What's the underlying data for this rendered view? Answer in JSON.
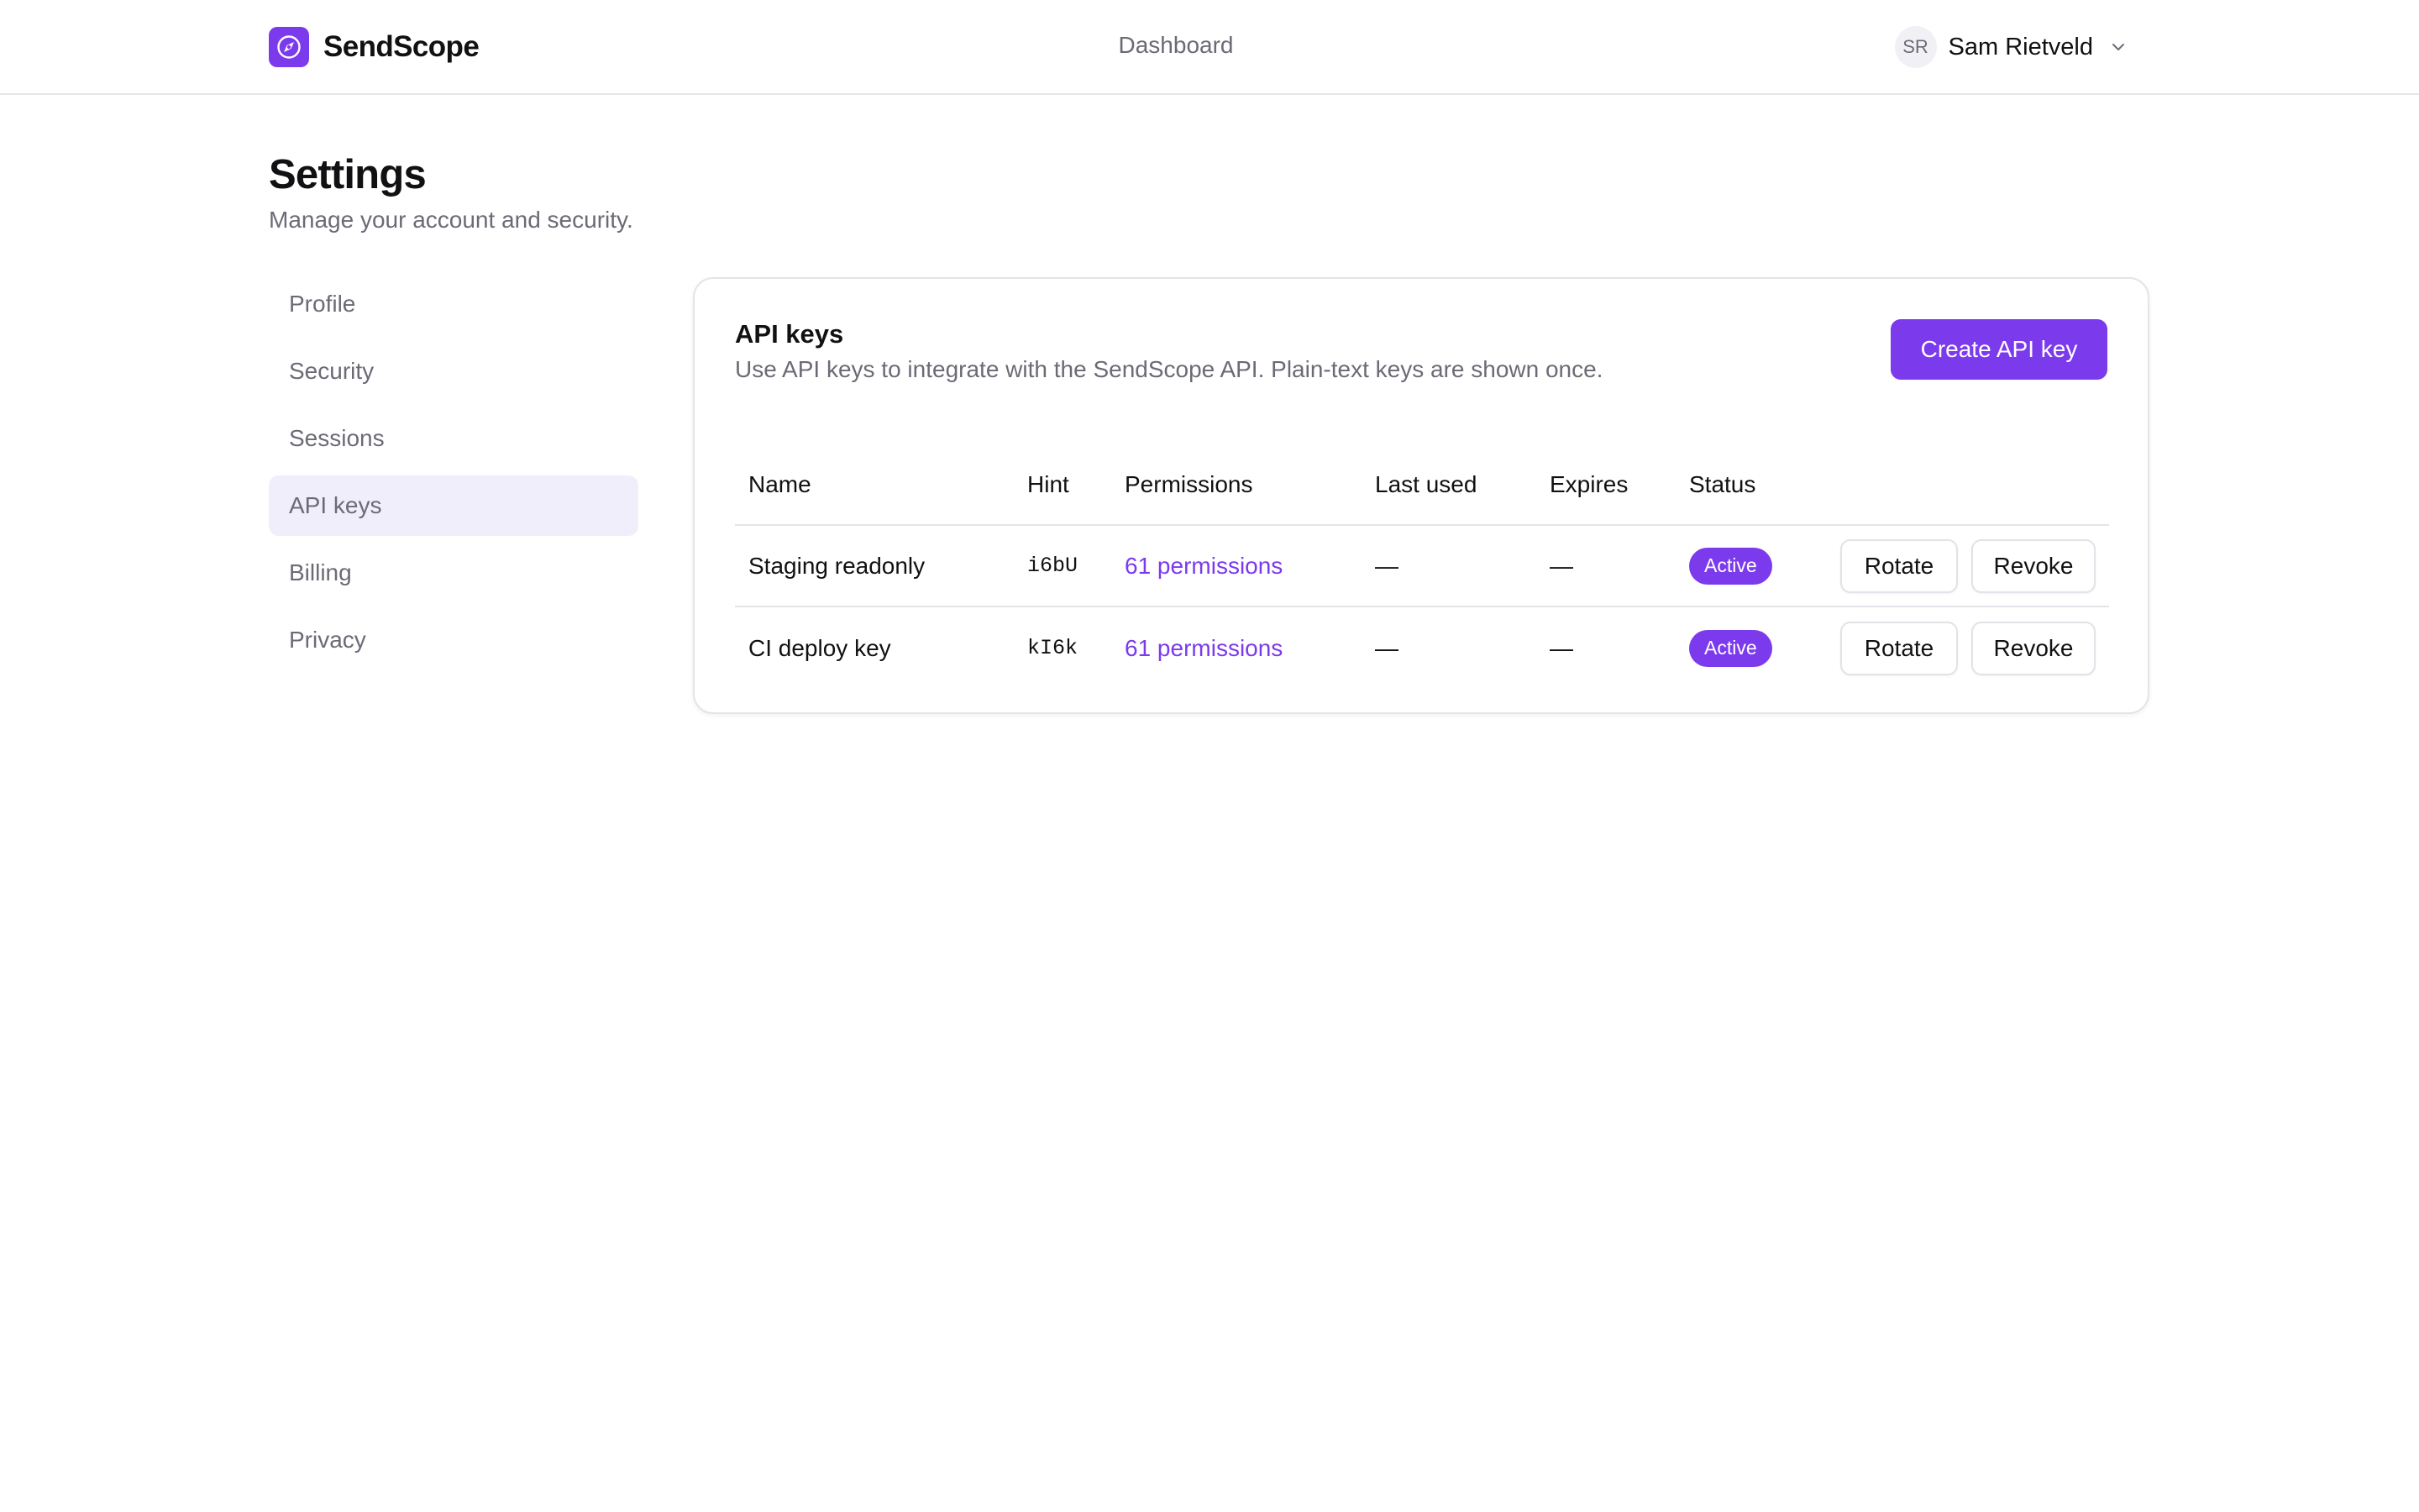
{
  "header": {
    "brand_name": "SendScope",
    "brand_icon": "compass-icon",
    "nav_link": "Dashboard",
    "user": {
      "initials": "SR",
      "name": "Sam Rietveld"
    }
  },
  "page": {
    "title": "Settings",
    "subtitle": "Manage your account and security."
  },
  "sidebar": {
    "items": [
      {
        "label": "Profile",
        "active": false
      },
      {
        "label": "Security",
        "active": false
      },
      {
        "label": "Sessions",
        "active": false
      },
      {
        "label": "API keys",
        "active": true
      },
      {
        "label": "Billing",
        "active": false
      },
      {
        "label": "Privacy",
        "active": false
      }
    ]
  },
  "card": {
    "title": "API keys",
    "description": "Use API keys to integrate with the SendScope API. Plain-text keys are shown once.",
    "create_button": "Create API key"
  },
  "table": {
    "columns": [
      "Name",
      "Hint",
      "Permissions",
      "Last used",
      "Expires",
      "Status"
    ],
    "rows": [
      {
        "name": "Staging readonly",
        "hint": "i6bU",
        "permissions": "61 permissions",
        "last_used": "—",
        "expires": "—",
        "status": "Active",
        "rotate_label": "Rotate",
        "revoke_label": "Revoke"
      },
      {
        "name": "CI deploy key",
        "hint": "kI6k",
        "permissions": "61 permissions",
        "last_used": "—",
        "expires": "—",
        "status": "Active",
        "rotate_label": "Rotate",
        "revoke_label": "Revoke"
      }
    ]
  },
  "colors": {
    "accent": "#7c3aed",
    "active_nav_bg": "#f1eefc",
    "muted_text": "#6b6b76",
    "border": "#e4e4e9"
  }
}
